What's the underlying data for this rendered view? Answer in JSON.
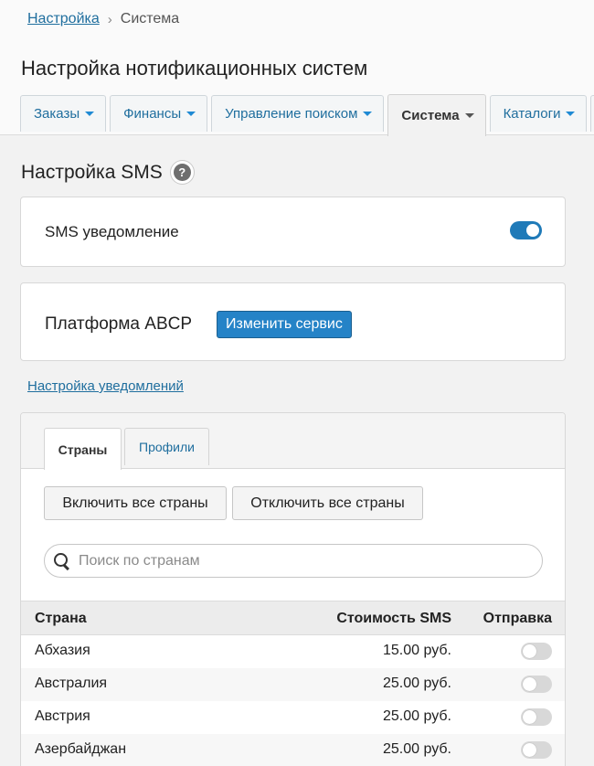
{
  "breadcrumb": {
    "parent": "Настройка",
    "current": "Система"
  },
  "page": {
    "title": "Настройка нотификационных систем"
  },
  "tabs": [
    {
      "label": "Заказы"
    },
    {
      "label": "Финансы"
    },
    {
      "label": "Управление поиском"
    },
    {
      "label": "Система"
    },
    {
      "label": "Каталоги"
    }
  ],
  "sms_section": {
    "title": "Настройка SMS",
    "help_glyph": "?"
  },
  "sms_toggle": {
    "label": "SMS уведомление",
    "enabled": true
  },
  "platform": {
    "label": "Платформа ABCP",
    "change_button": "Изменить сервис"
  },
  "notifications_link": "Настройка уведомлений",
  "panel": {
    "tabs": [
      "Страны",
      "Профили"
    ],
    "enable_all": "Включить все страны",
    "disable_all": "Отключить все страны",
    "search_placeholder": "Поиск по странам",
    "columns": {
      "country": "Страна",
      "cost": "Стоимость SMS",
      "send": "Отправка"
    },
    "rows": [
      {
        "country": "Абхазия",
        "cost": "15.00 руб.",
        "send": false
      },
      {
        "country": "Австралия",
        "cost": "25.00 руб.",
        "send": false
      },
      {
        "country": "Австрия",
        "cost": "25.00 руб.",
        "send": false
      },
      {
        "country": "Азербайджан",
        "cost": "25.00 руб.",
        "send": false
      }
    ]
  },
  "colors": {
    "link": "#1f6e9e",
    "accent": "#2583c7",
    "toggle_on": "#1f7ab8"
  }
}
